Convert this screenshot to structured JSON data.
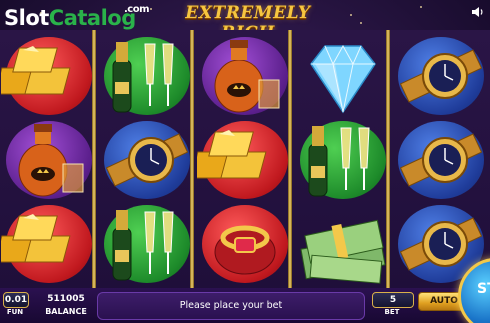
{
  "header": {
    "brand_part1": "Slot",
    "brand_part2": "Catalog",
    "brand_suffix": ".com",
    "game_title": "EXTREMELY RICH",
    "sound_icon": "speaker-icon"
  },
  "reels": [
    [
      "gold-bars",
      "cognac",
      "gold-bars"
    ],
    [
      "champagne",
      "watch",
      "champagne"
    ],
    [
      "cognac",
      "gold-bars",
      "ring"
    ],
    [
      "diamond",
      "champagne",
      "money"
    ],
    [
      "watch",
      "watch",
      "watch"
    ]
  ],
  "bottom": {
    "coin_value": "0.01",
    "coin_label": "FUN",
    "balance_value": "511005",
    "balance_label": "BALANCE",
    "message": "Please place your bet",
    "bet_value": "5",
    "bet_label": "BET",
    "auto_label": "AUTO",
    "spin_label": "ST"
  },
  "colors": {
    "accent_gold": "#f3c84a",
    "brand_green": "#2ab24a",
    "background": "#1e0f35"
  }
}
